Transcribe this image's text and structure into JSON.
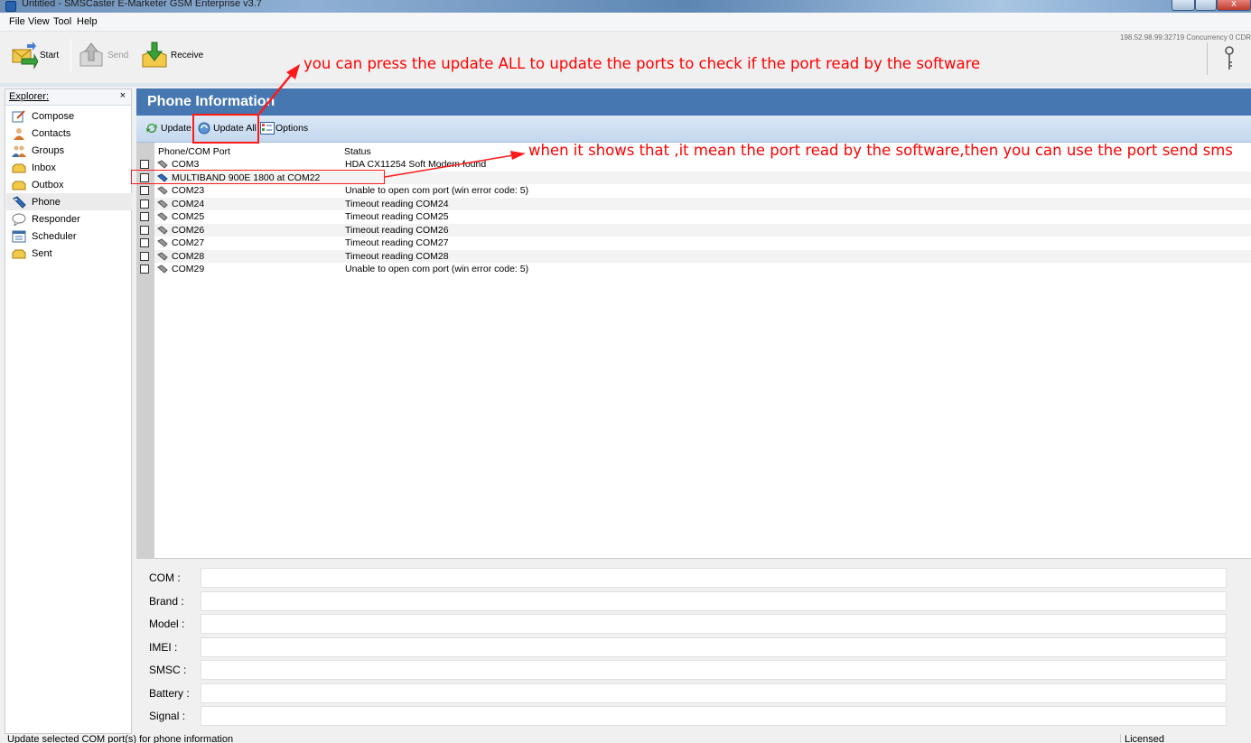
{
  "window": {
    "title": "Untitled - SMSCaster E-Marketer GSM Enterprise v3.7",
    "close_glyph": "x"
  },
  "menu": [
    "File",
    "View",
    "Tool",
    "Help"
  ],
  "toolbar": {
    "start_label": "Start",
    "send_label": "Send",
    "receive_label": "Receive",
    "connection_info": "198.52.98.99:32719 Concurrency 0 CDR"
  },
  "annotations": {
    "top_note": "you can press the update ALL to update the ports  to check if the port read by the software",
    "row_note": "when it shows that ,it mean the port read by the software,then you can use the port send sms"
  },
  "sidebar": {
    "title": "Explorer:",
    "close_glyph": "×",
    "items": [
      {
        "label": "Compose",
        "icon": "compose-icon"
      },
      {
        "label": "Contacts",
        "icon": "contacts-icon"
      },
      {
        "label": "Groups",
        "icon": "groups-icon"
      },
      {
        "label": "Inbox",
        "icon": "inbox-icon"
      },
      {
        "label": "Outbox",
        "icon": "outbox-icon"
      },
      {
        "label": "Phone",
        "icon": "phone-icon",
        "active": true
      },
      {
        "label": "Responder",
        "icon": "responder-icon"
      },
      {
        "label": "Scheduler",
        "icon": "scheduler-icon"
      },
      {
        "label": "Sent",
        "icon": "sent-icon"
      }
    ]
  },
  "phone_panel": {
    "title": "Phone Information",
    "toolbar": {
      "update_label": "Update",
      "update_all_label": "Update All",
      "options_label": "Options"
    },
    "columns": [
      "Phone/COM Port",
      "Status"
    ],
    "rows": [
      {
        "port": "COM3",
        "status": "HDA CX11254 Soft Modem found"
      },
      {
        "port": "MULTIBAND  900E  1800  at COM22",
        "status": ""
      },
      {
        "port": "COM23",
        "status": "Unable to open com port (win error code: 5)"
      },
      {
        "port": "COM24",
        "status": "Timeout reading COM24"
      },
      {
        "port": "COM25",
        "status": "Timeout reading COM25"
      },
      {
        "port": "COM26",
        "status": "Timeout reading COM26"
      },
      {
        "port": "COM27",
        "status": "Timeout reading COM27"
      },
      {
        "port": "COM28",
        "status": "Timeout reading COM28"
      },
      {
        "port": "COM29",
        "status": "Unable to open com port (win error code: 5)"
      }
    ],
    "details": {
      "com_label": "COM :",
      "brand_label": "Brand :",
      "model_label": "Model :",
      "imei_label": "IMEI :",
      "smsc_label": "SMSC :",
      "battery_label": "Battery :",
      "signal_label": "Signal :"
    }
  },
  "statusbar": {
    "message": "Update selected COM port(s) for phone information",
    "license": "Licensed"
  },
  "colors": {
    "annotation": "#ff0000",
    "panel_header": "#4677b0",
    "panel_toolbar": "#c3d7ee"
  }
}
